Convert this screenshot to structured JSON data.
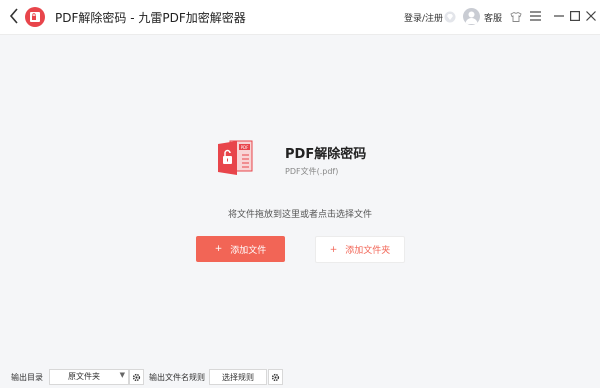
{
  "titlebar": {
    "app_title": "PDF解除密码 - 九雷PDF加密解密器",
    "login_label": "登录/注册",
    "support_label": "客服"
  },
  "hero": {
    "title": "PDF解除密码",
    "subtitle": "PDF文件(.pdf)",
    "icon_badge": "PDF"
  },
  "drop_hint": "将文件拖放到这里或者点击选择文件",
  "actions": {
    "add_file_label": "添加文件",
    "add_folder_label": "添加文件夹",
    "plus": "+"
  },
  "footer": {
    "output_dir_label": "输出目录",
    "output_dir_value": "原文件夹",
    "naming_label": "输出文件名规则",
    "rule_button_label": "选择规则"
  },
  "colors": {
    "accent": "#f26556",
    "logo_red": "#e8454b",
    "background": "#f5f6f8"
  }
}
